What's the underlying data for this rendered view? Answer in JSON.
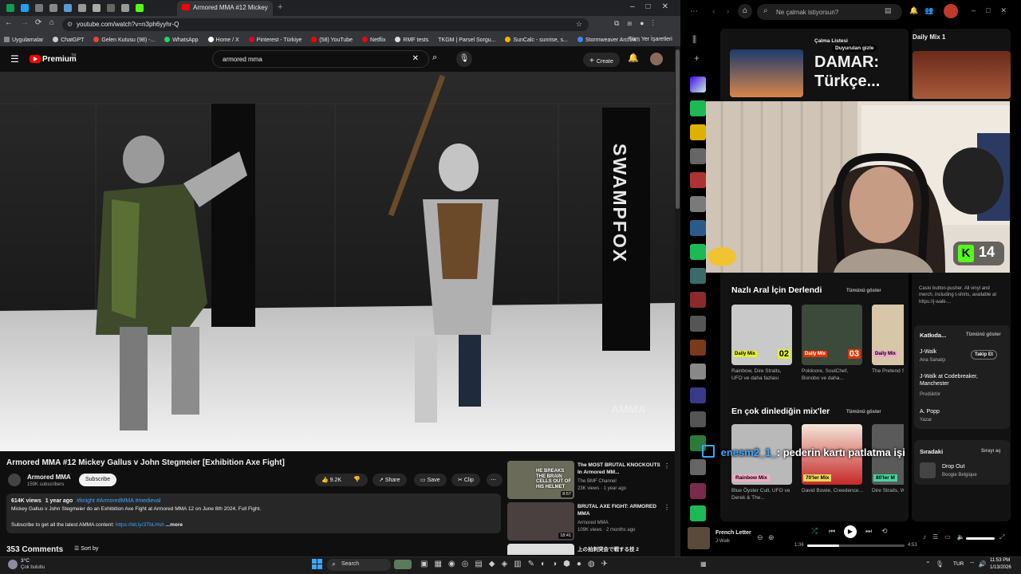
{
  "browser": {
    "active_tab": "Armored MMA #12 Mickey",
    "url": "youtube.com/watch?v=n3ph6yyhr-Q",
    "bookmarks": [
      "Uygulamalar",
      "ChatGPT",
      "Gelen Kutusu (98) -...",
      "WhatsApp",
      "Home / X",
      "Pinterest - Türkiye",
      "(58) YouTube",
      "Netflix",
      "RMF tests",
      "TKGM | Parsel Sorgu...",
      "SunCalc - sunrise, s...",
      "Stormweaver Archm..."
    ],
    "bookmarks_all": "Tüm Yer İşaretleri"
  },
  "youtube": {
    "logo": "Premium",
    "logo_region": "TR",
    "search_value": "armored mma",
    "create_label": "Create",
    "video_watermark_right": "SWAMPFOX",
    "video_watermark_small": "AMMA",
    "title": "Armored MMA #12 Mickey Gallus v John Stegmeier [Exhibition Axe Fight]",
    "channel": "Armored MMA",
    "subscribers": "159K subscribers",
    "subscribe_label": "Subscribe",
    "likes": "9.2K",
    "share_label": "Share",
    "save_label": "Save",
    "clip_label": "Clip",
    "views": "614K views",
    "age": "1 year ago",
    "tags": "#knight #ArmoredMMA #medieval",
    "description": "Mickey Gallus v John Stegmeier do an Exhibition Axe Fight at Armored MMA 12 on June 8th 2024. Full Fight.",
    "subscribe_line": "Subscribe to get all the latest AMMA content:",
    "subscribe_link": "https://bit.ly/3TbLHsh",
    "more_label": "...more",
    "comments": "353 Comments",
    "sort_label": "Sort by",
    "recommendations": [
      {
        "title": "The MOST BRUTAL KNOCKOUTS In Armored MM...",
        "channel": "The BMF Channel",
        "meta": "23K views · 1 year ago",
        "duration": "8:57",
        "thumb_text": "HE BREAKS THE BRAIN CELLS OUT OF HIS HELMET"
      },
      {
        "title": "BRUTAL AXE FIGHT: ARMORED MMA",
        "channel": "Armored MMA",
        "meta": "109K views · 2 months ago",
        "duration": "18:41",
        "thumb_text": ""
      },
      {
        "title": "上の拍刺突会で戦する技 2",
        "channel": "",
        "meta": "",
        "duration": "",
        "thumb_text": ""
      }
    ]
  },
  "spotify": {
    "search_placeholder": "Ne çalmak istiyorsun?",
    "playlist_label": "Çalma Listesi",
    "ad_label": "Duyurulan gizle",
    "hero_title": "DAMAR: Türkçe...",
    "daily_mix_header": "Daily Mix 1",
    "section1_title": "Nazlı Aral İçin Derlendi",
    "show_all": "Tümünü göster",
    "mixes": [
      {
        "badge": "Daily Mix",
        "num": "02",
        "text": "Rainbow, Dire Straits, UFO ve daha fazlası"
      },
      {
        "badge": "Daily Mix",
        "num": "03",
        "text": "Poldoore, SoulChef, Bonobo ve daha..."
      },
      {
        "badge": "Daily Mix",
        "num": "",
        "text": "The Pretend Shivaree"
      }
    ],
    "section2_title": "En çok dinlediğin mix'ler",
    "mixes2": [
      {
        "badge": "Rainbow Mix",
        "text": "Blue Öyster Cult, UFO ve Derek & The..."
      },
      {
        "badge": "70'ler Mix",
        "text": "David Bowie, Creedence..."
      },
      {
        "badge": "80'ler M",
        "text": "Dire Straits, Whitesnake"
      }
    ],
    "right_desc": "Casio button-pusher. All vinyl and merch, including t-shirts, available at https://j-walk-...",
    "right_desc_top": "ilelenyici",
    "contributors_title": "Katkıda...",
    "contributors": [
      {
        "name": "J-Walk",
        "role": "Ana Sanatçı",
        "button": "Takip Et"
      },
      {
        "name": "J-Walk at Codebreaker, Manchester",
        "role": "Prodüktör"
      },
      {
        "name": "A. Popp",
        "role": "Yazar"
      }
    ],
    "queue_title": "Sıradaki",
    "queue_open": "Sırayı aç",
    "queue_track": "Drop Out",
    "queue_artist": "Boogie Belgique",
    "now_track": "French Letter",
    "now_artist": "J-Walk",
    "time_elapsed": "1:36",
    "time_total": "4:53",
    "progress": 0.33
  },
  "overlay": {
    "kick_count": "14",
    "chat_user": "enesm2_1_",
    "chat_msg": ": pederin kartı patlatma işi"
  },
  "taskbar": {
    "weather_temp": "3°C",
    "weather_text": "Çok bulutlu",
    "search_label": "Search",
    "lang": "TUR",
    "time": "11:53 PM",
    "date": "1/13/2026"
  }
}
